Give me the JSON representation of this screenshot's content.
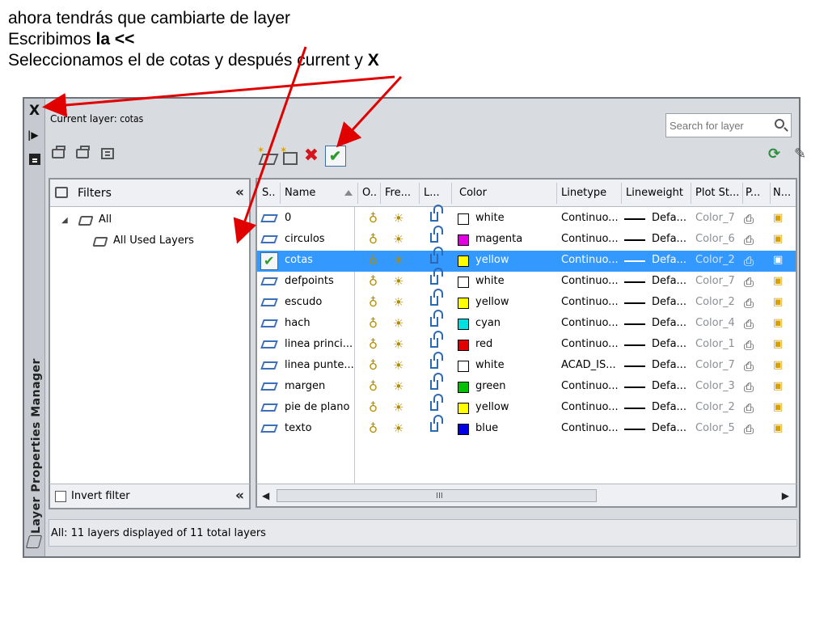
{
  "slide": {
    "line1": "ahora tendrás que cambiarte de layer",
    "line2_prefix": "Escribimos ",
    "line2_bold": "la <<",
    "line3_prefix": "Seleccionamos el de cotas y después current y ",
    "line3_bold": "X"
  },
  "palette": {
    "title": "Layer Properties Manager",
    "close_label": "X",
    "current_layer_label": "Current layer:",
    "current_layer_value": "cotas",
    "search_placeholder": "Search for layer",
    "filters_header": "Filters",
    "tree_all": "All",
    "tree_used": "All Used Layers",
    "invert_filter": "Invert filter",
    "status": "All: 11 layers displayed of 11 total layers",
    "collapse_glyph": "«"
  },
  "columns": {
    "status": "S..",
    "name": "Name",
    "on": "O..",
    "freeze": "Fre...",
    "lock": "L...",
    "color": "Color",
    "linetype": "Linetype",
    "lineweight": "Lineweight",
    "plotstyle": "Plot St...",
    "plot": "P...",
    "newvp": "N..."
  },
  "layers": [
    {
      "name": "0",
      "color": "white",
      "swatch": "#ffffff",
      "linetype": "Continuo...",
      "lineweight": "Defa...",
      "plotstyle": "Color_7",
      "current": false
    },
    {
      "name": "circulos",
      "color": "magenta",
      "swatch": "#e000e0",
      "linetype": "Continuo...",
      "lineweight": "Defa...",
      "plotstyle": "Color_6",
      "current": false
    },
    {
      "name": "cotas",
      "color": "yellow",
      "swatch": "#ffff00",
      "linetype": "Continuo...",
      "lineweight": "Defa...",
      "plotstyle": "Color_2",
      "current": true
    },
    {
      "name": "defpoints",
      "color": "white",
      "swatch": "#ffffff",
      "linetype": "Continuo...",
      "lineweight": "Defa...",
      "plotstyle": "Color_7",
      "current": false
    },
    {
      "name": "escudo",
      "color": "yellow",
      "swatch": "#ffff00",
      "linetype": "Continuo...",
      "lineweight": "Defa...",
      "plotstyle": "Color_2",
      "current": false
    },
    {
      "name": "hach",
      "color": "cyan",
      "swatch": "#00e0e0",
      "linetype": "Continuo...",
      "lineweight": "Defa...",
      "plotstyle": "Color_4",
      "current": false
    },
    {
      "name": "linea princi...",
      "color": "red",
      "swatch": "#e00000",
      "linetype": "Continuo...",
      "lineweight": "Defa...",
      "plotstyle": "Color_1",
      "current": false
    },
    {
      "name": "linea punte...",
      "color": "white",
      "swatch": "#ffffff",
      "linetype": "ACAD_IS...",
      "lineweight": "Defa...",
      "plotstyle": "Color_7",
      "current": false
    },
    {
      "name": "margen",
      "color": "green",
      "swatch": "#00c000",
      "linetype": "Continuo...",
      "lineweight": "Defa...",
      "plotstyle": "Color_3",
      "current": false
    },
    {
      "name": "pie de plano",
      "color": "yellow",
      "swatch": "#ffff00",
      "linetype": "Continuo...",
      "lineweight": "Defa...",
      "plotstyle": "Color_2",
      "current": false
    },
    {
      "name": "texto",
      "color": "blue",
      "swatch": "#0000e0",
      "linetype": "Continuo...",
      "lineweight": "Defa...",
      "plotstyle": "Color_5",
      "current": false
    }
  ],
  "colors": {
    "selection": "#3399ff",
    "arrow": "#e00000"
  }
}
